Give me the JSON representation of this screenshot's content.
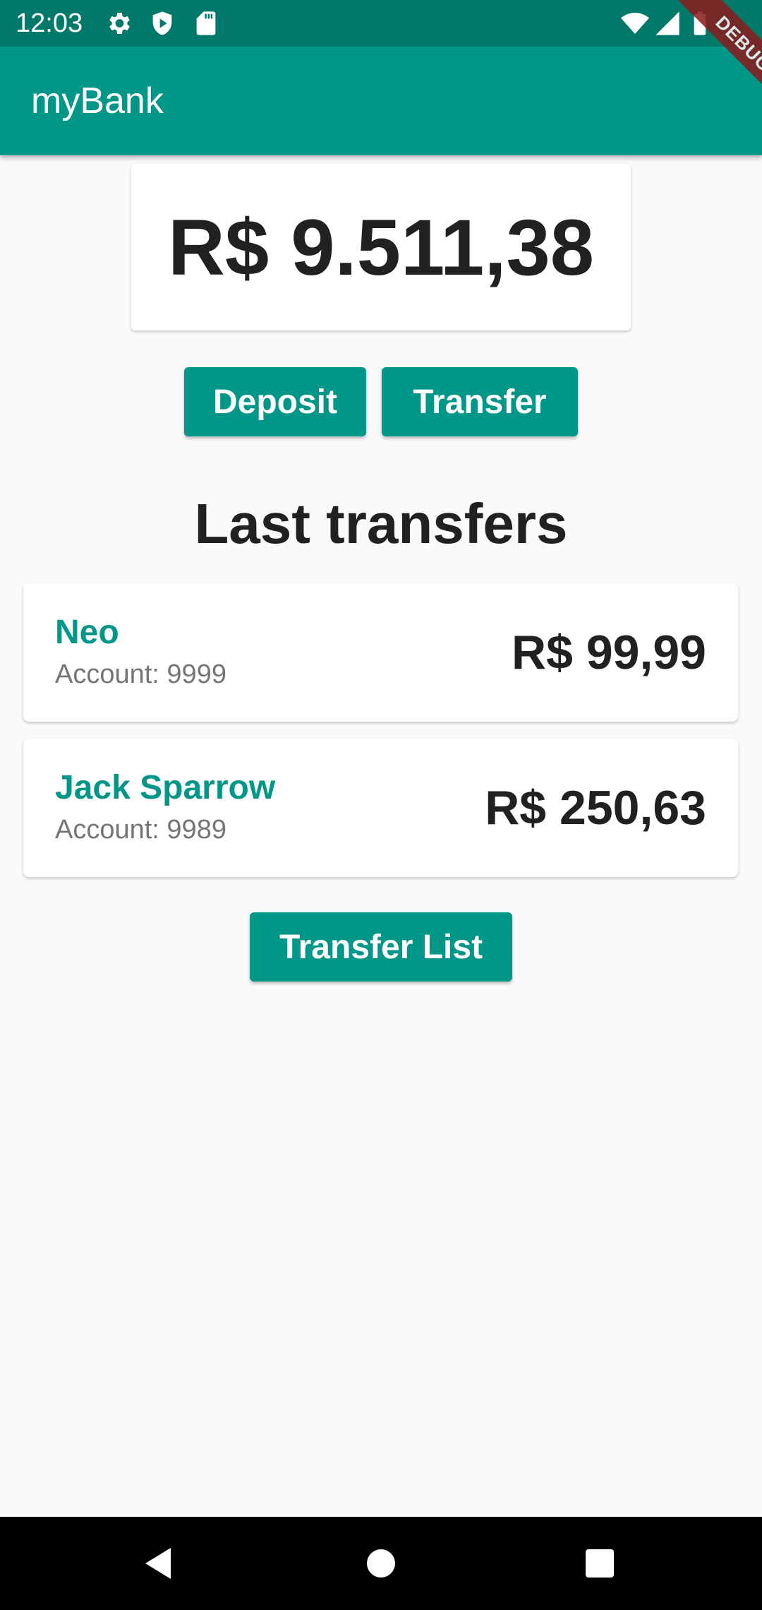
{
  "status_bar": {
    "time": "12:03",
    "icons": [
      "settings-icon",
      "shield-play-icon",
      "sd-card-icon",
      "wifi-icon",
      "signal-icon",
      "battery-icon"
    ]
  },
  "app_bar": {
    "title": "myBank",
    "debug_label": "DEBUG"
  },
  "balance": {
    "amount": "R$ 9.511,38"
  },
  "actions": {
    "deposit_label": "Deposit",
    "transfer_label": "Transfer"
  },
  "transfers_section": {
    "title": "Last transfers",
    "items": [
      {
        "name": "Neo",
        "account": "Account: 9999",
        "value": "R$ 99,99"
      },
      {
        "name": "Jack Sparrow",
        "account": "Account: 9989",
        "value": "R$ 250,63"
      }
    ],
    "list_button_label": "Transfer List"
  },
  "nav_bar": {
    "icons": [
      "back-icon",
      "home-icon",
      "recents-icon"
    ]
  },
  "colors": {
    "primary": "#009688",
    "primary_dark": "#00796b",
    "background": "#fafafa",
    "text_dark": "#212121",
    "text_secondary": "#757575"
  }
}
